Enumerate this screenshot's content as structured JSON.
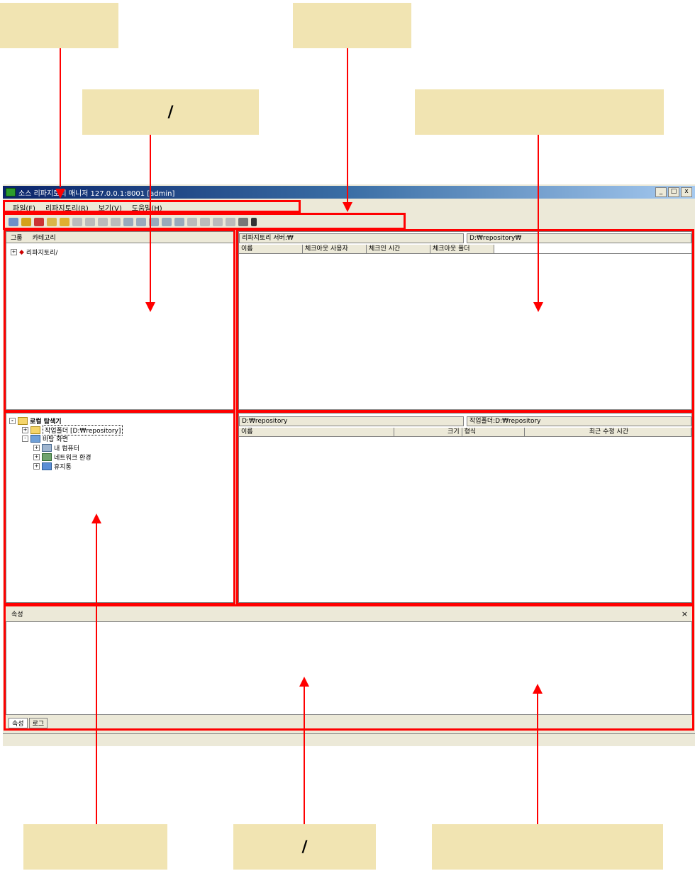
{
  "callouts": {
    "top_left_1": "",
    "top_middle_2": "",
    "top_left_slash": "/",
    "top_right_wide": "",
    "bottom_left": "",
    "bottom_middle_slash": "/",
    "bottom_right_wide": ""
  },
  "window": {
    "title": "소스 리파지토리 매니저 127.0.0.1:8001 [admin]",
    "min_label": "_",
    "max_label": "□",
    "close_label": "x"
  },
  "menu": [
    "파일(F)",
    "리파지토리(R)",
    "보기(V)",
    "도움말(H)"
  ],
  "left_top": {
    "tab_group": "그룹",
    "tab_category": "카테고리",
    "tree_root": "리파지토리/"
  },
  "right_top": {
    "path_left": "리파지토리 서버:₩",
    "path_right": "D:₩repository₩",
    "columns": [
      "이름",
      "체크아웃 사용자",
      "체크인 시간",
      "체크아웃 폴더"
    ]
  },
  "left_bottom": {
    "root": "로컬 탐색기",
    "work_folder": "작업폴더 [D:₩repository]",
    "desktop": "바탕 화면",
    "my_computer": "내 컴퓨터",
    "network": "네트워크 환경",
    "recycle": "휴지통"
  },
  "right_bottom": {
    "path_left": "D:₩repository",
    "path_right": "작업폴더:D:₩repository",
    "columns": [
      "이름",
      "크기",
      "형식",
      "최근 수정 시간"
    ]
  },
  "props": {
    "title": "속성",
    "close": "×",
    "tab_props": "속성",
    "tab_log": "로그"
  },
  "colors": {
    "highlight": "#ff0000",
    "callout": "#f1e4b2",
    "window_bg": "#ece9d8",
    "title_start": "#0a246a"
  }
}
